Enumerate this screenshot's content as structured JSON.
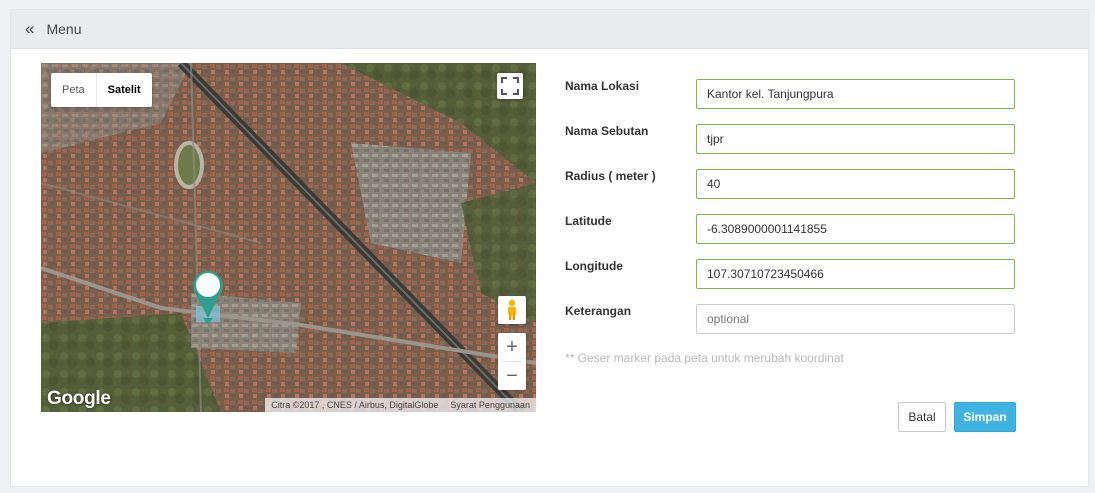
{
  "header": {
    "menu_icon": "double-chevron-left-icon",
    "menu_label": "Menu"
  },
  "map": {
    "type_buttons": [
      "Peta",
      "Satelit"
    ],
    "active_type": "Satelit",
    "logo": "Google",
    "attribution": "Citra ©2017 , CNES / Airbus, DigitalGlobe",
    "terms": "Syarat Penggunaan",
    "zoom_in": "+",
    "zoom_out": "−",
    "icons": [
      "fullscreen-icon",
      "pegman-icon",
      "map-marker-icon"
    ]
  },
  "form": {
    "nama_lokasi": {
      "label": "Nama Lokasi",
      "value": "Kantor kel. Tanjungpura"
    },
    "nama_sebutan": {
      "label": "Nama Sebutan",
      "value": "tjpr"
    },
    "radius": {
      "label": "Radius ( meter )",
      "value": "40"
    },
    "latitude": {
      "label": "Latitude",
      "value": "-6.3089000001141855"
    },
    "longitude": {
      "label": "Longitude",
      "value": "107.30710723450466"
    },
    "keterangan": {
      "label": "Keterangan",
      "value": "",
      "placeholder": "optional"
    },
    "hint": "** Geser marker pada peta untuk merubah koordinat"
  },
  "actions": {
    "cancel": "Batal",
    "save": "Simpan"
  },
  "colors": {
    "input_border_valid": "#7fb743",
    "save_button": "#3eb4e2",
    "header_bg": "#e9ebee"
  }
}
